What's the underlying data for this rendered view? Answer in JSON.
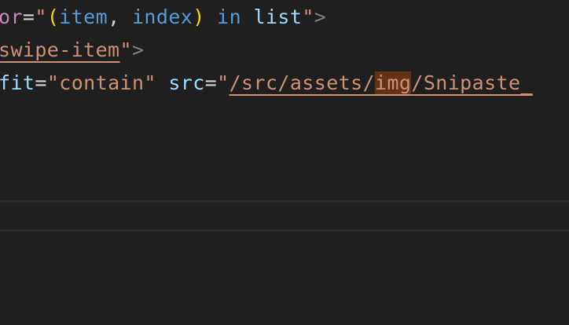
{
  "editor": {
    "line1": {
      "attr": "or",
      "eq": "=",
      "quote_open": "\"",
      "paren_open": "(",
      "item": "item",
      "comma": ", ",
      "index": "index",
      "paren_close": ")",
      "space1": " ",
      "in": "in",
      "space2": " ",
      "list": "list",
      "quote_close": "\"",
      "gt": ">"
    },
    "line2": {
      "tag": "swipe-item",
      "quote_close": "\"",
      "gt": ">"
    },
    "line3": {
      "attr": "fit",
      "eq": "=",
      "value": "\"contain\"",
      "space": " ",
      "src_attr": "src",
      "eq2": "=",
      "quote_open": "\"",
      "path_before": "/src/assets/",
      "path_highlight": "img",
      "path_after": "/Snipaste_"
    }
  },
  "colors": {
    "background": "#1f1f1f",
    "string": "#ce9178",
    "attribute": "#9cdcfe",
    "keyword": "#569cd6",
    "bracket": "#ffd700",
    "highlight": "#613214"
  }
}
